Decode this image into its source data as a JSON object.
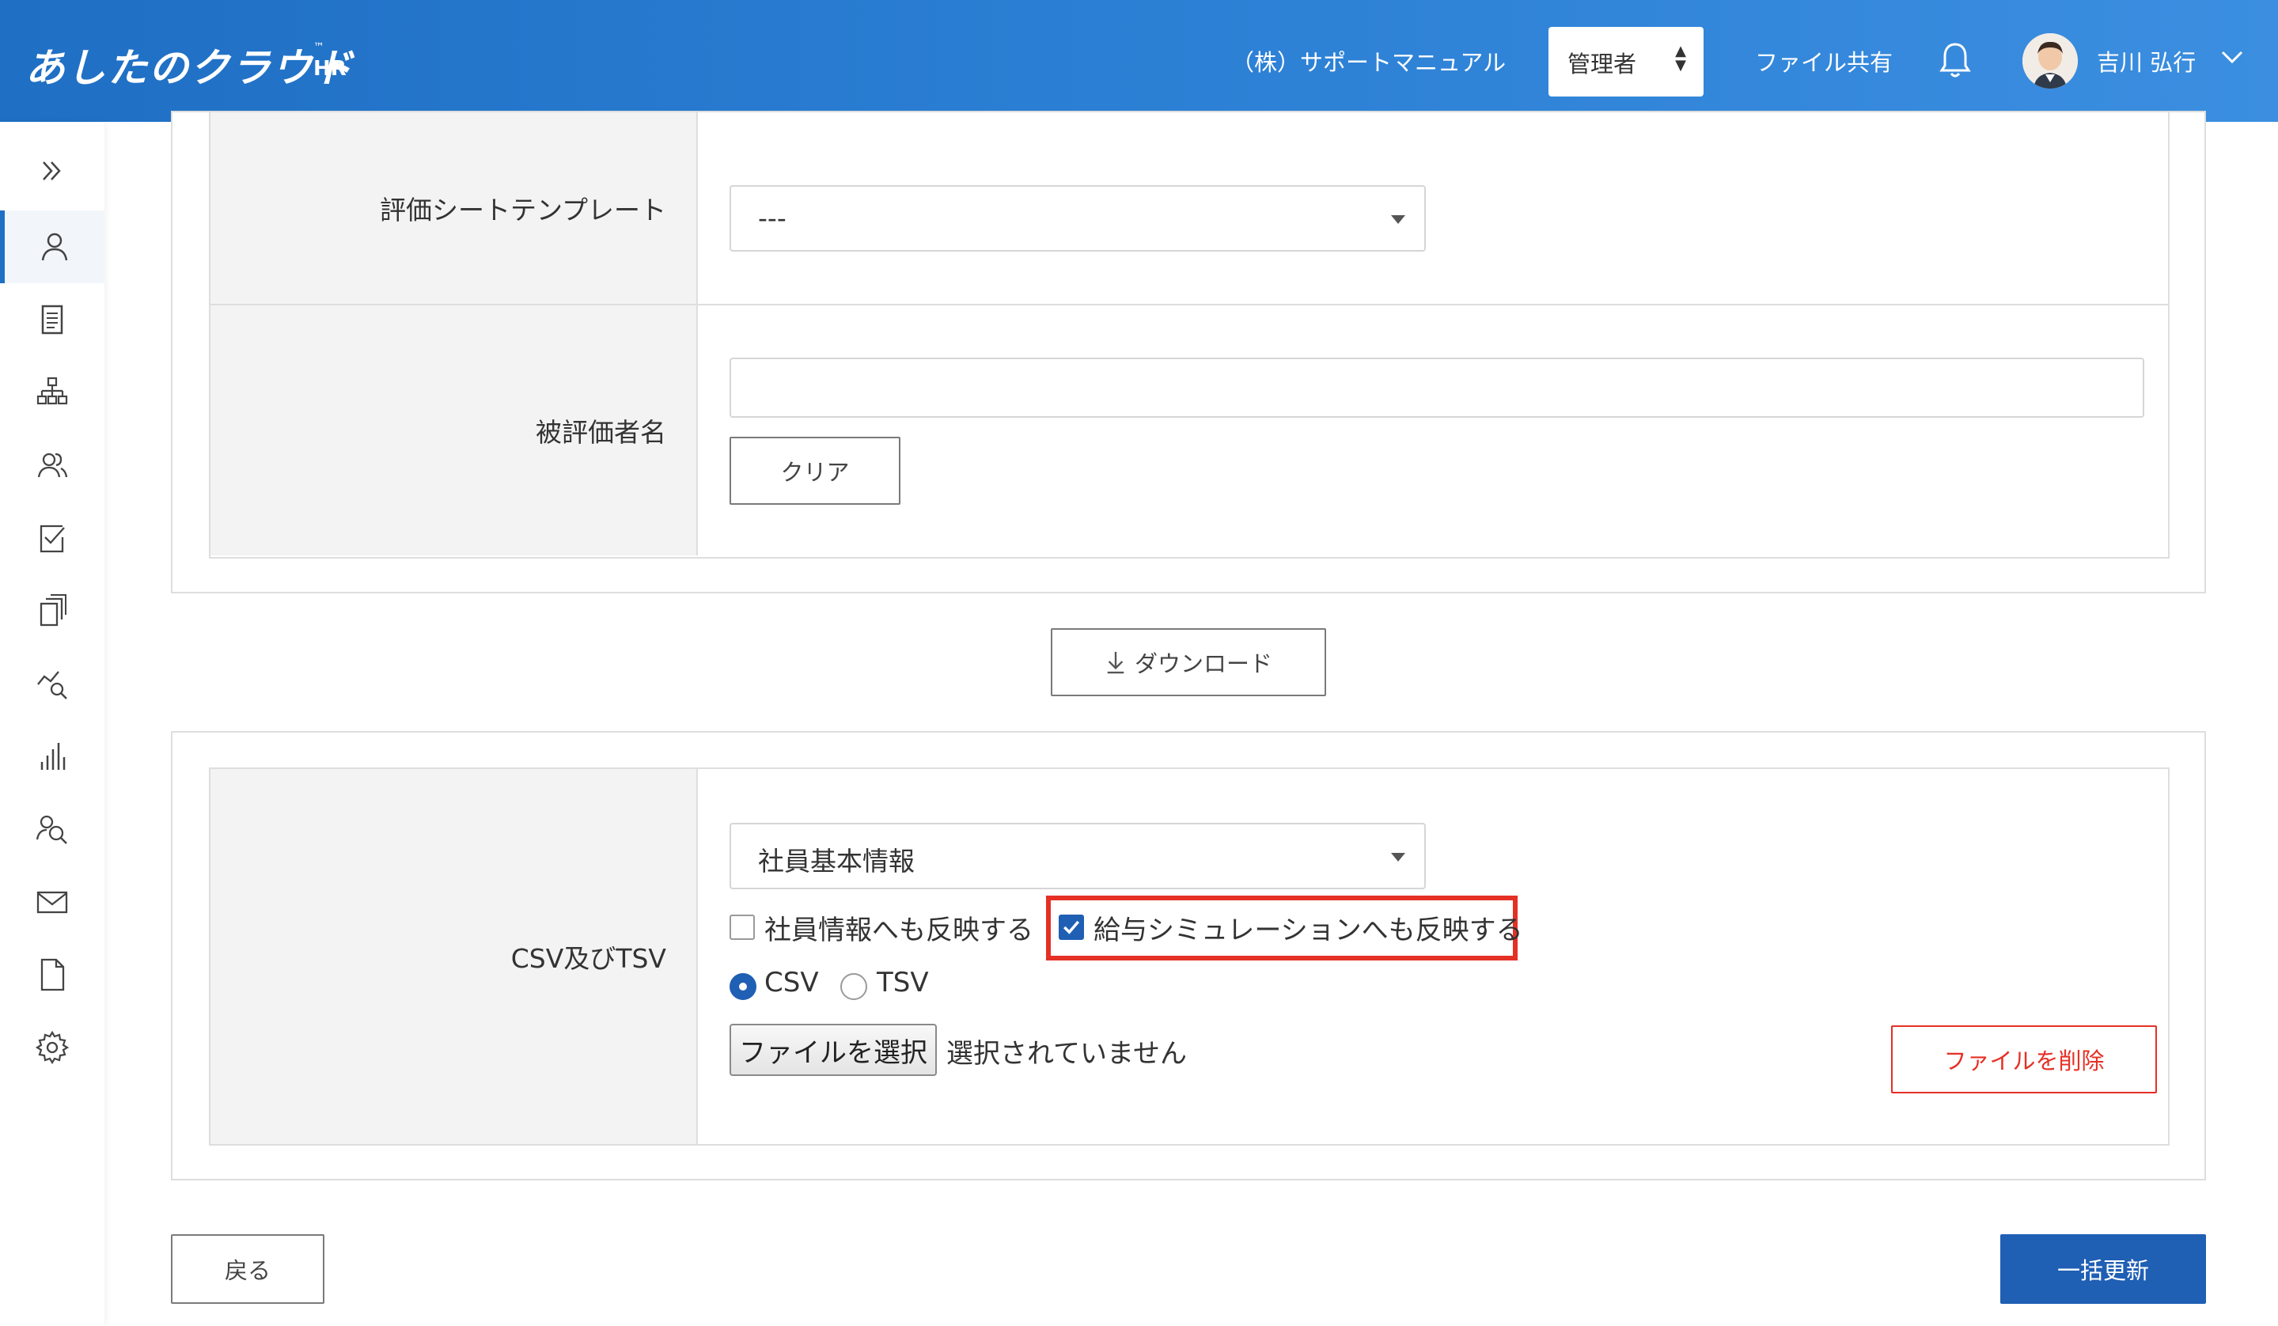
{
  "header": {
    "logo_text": "あしたのクラウド",
    "logo_tm": "™",
    "logo_suffix": "HR",
    "company": "（株）サポートマニュアル",
    "role": "管理者",
    "file_share": "ファイル共有",
    "user_name": "吉川 弘行"
  },
  "sidebar": {
    "items": [
      {
        "icon": "double-chevron-right-icon"
      },
      {
        "icon": "user-icon",
        "active": true
      },
      {
        "icon": "document-icon"
      },
      {
        "icon": "org-chart-icon"
      },
      {
        "icon": "users-icon"
      },
      {
        "icon": "checklist-icon"
      },
      {
        "icon": "copy-icon"
      },
      {
        "icon": "analytics-search-icon"
      },
      {
        "icon": "bar-chart-icon"
      },
      {
        "icon": "person-search-icon"
      },
      {
        "icon": "mail-icon"
      },
      {
        "icon": "file-icon"
      },
      {
        "icon": "gear-icon"
      }
    ]
  },
  "search_form": {
    "template_label": "評価シートテンプレート",
    "template_value": "---",
    "evaluatee_label": "被評価者名",
    "evaluatee_value": "",
    "clear_button": "クリア"
  },
  "download_button": "ダウンロード",
  "upload_form": {
    "csv_label": "CSV及びTSV",
    "data_type_value": "社員基本情報",
    "reflect_employee_label": "社員情報へも反映する",
    "reflect_employee_checked": false,
    "reflect_salary_label": "給与シミュレーションへも反映する",
    "reflect_salary_checked": true,
    "format_options": [
      {
        "label": "CSV",
        "checked": true
      },
      {
        "label": "TSV",
        "checked": false
      }
    ],
    "choose_file_button": "ファイルを選択",
    "no_file_text": "選択されていません",
    "delete_file_button": "ファイルを削除"
  },
  "footer": {
    "back_button": "戻る",
    "bulk_update_button": "一括更新"
  },
  "colors": {
    "header_blue": "#1f6fc4",
    "primary_button": "#1f5fb4",
    "danger": "#e53025",
    "highlight": "#e53025"
  }
}
